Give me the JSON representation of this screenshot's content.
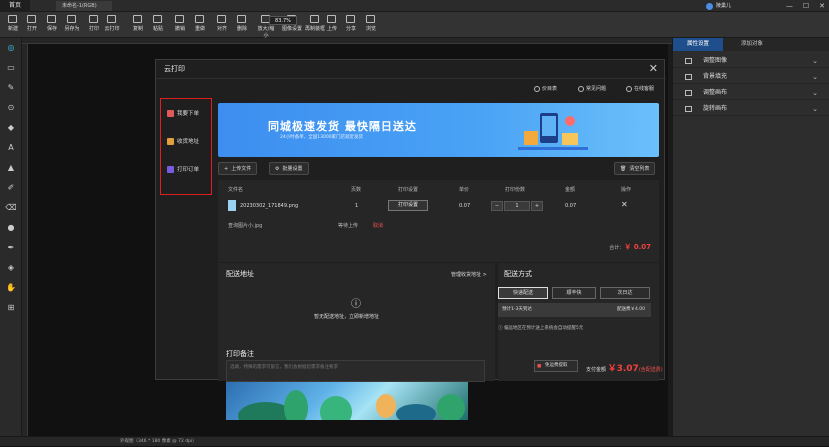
{
  "topbar": {
    "home": "首页",
    "tab": "未命名-1(RGB)",
    "user": "陵巢儿"
  },
  "toolbar": {
    "items": [
      "新建",
      "打开",
      "保存",
      "另存为",
      "打印",
      "云打印",
      "复制",
      "粘贴",
      "撤销",
      "重做",
      "对齐",
      "删除",
      "放大/缩小",
      "图像设置",
      "再制装框",
      "上传",
      "分享",
      "浏览"
    ],
    "zoom": "83.7%"
  },
  "dialog": {
    "title": "云打印",
    "links": [
      "价目表",
      "常见问题",
      "在线客服"
    ],
    "nav": [
      "我要下单",
      "收货地址",
      "打印订单"
    ],
    "banner": {
      "title": "同城极速发货  最快隔日送达",
      "subtitle": "24小时备单，全国13000家门店就近发货"
    },
    "actions": {
      "upload": "上传文件",
      "batch": "批量设置",
      "clear": "清空列表"
    },
    "table": {
      "headers": [
        "文件名",
        "页数",
        "打印设置",
        "单价",
        "打印份数",
        "金额",
        "操作"
      ],
      "row": {
        "file": "20230302_171849.png",
        "pages": "1",
        "setting": "打印设置",
        "price": "0.07",
        "qty": "1",
        "amount": "0.07"
      },
      "row2": {
        "file": "查询图片小.jpg",
        "status": "等待上传",
        "cancel": "取消"
      },
      "total_label": "合计：",
      "total_value": "￥ 0.07"
    },
    "address": {
      "title": "配送地址",
      "manage": "管理收货地址 >",
      "empty": "暂无配送地址，立即新增地址"
    },
    "shipping": {
      "title": "配送方式",
      "options": [
        "快递配送",
        "顺丰快",
        "次日达"
      ],
      "info_left": "预计1-3天到达",
      "info_right": "配送费￥4.00",
      "note": "偏远地区在预计送上系统会自动提醒5元"
    },
    "remark": {
      "title": "打印备注",
      "placeholder": "选填，特殊的需求可留言，我们会根据您需求备注要求"
    },
    "pay": {
      "button": "免运费提取",
      "label": "支付金额",
      "amount": "￥3.07",
      "suffix": "(含配送费)"
    }
  },
  "right_panel": {
    "tabs": [
      "属性设置",
      "添加对象"
    ],
    "rows": [
      "调整图像",
      "背景填充",
      "调整画布",
      "旋转画布"
    ]
  },
  "status": "外观图（346 * 180 像素 @ 72 dpi）"
}
